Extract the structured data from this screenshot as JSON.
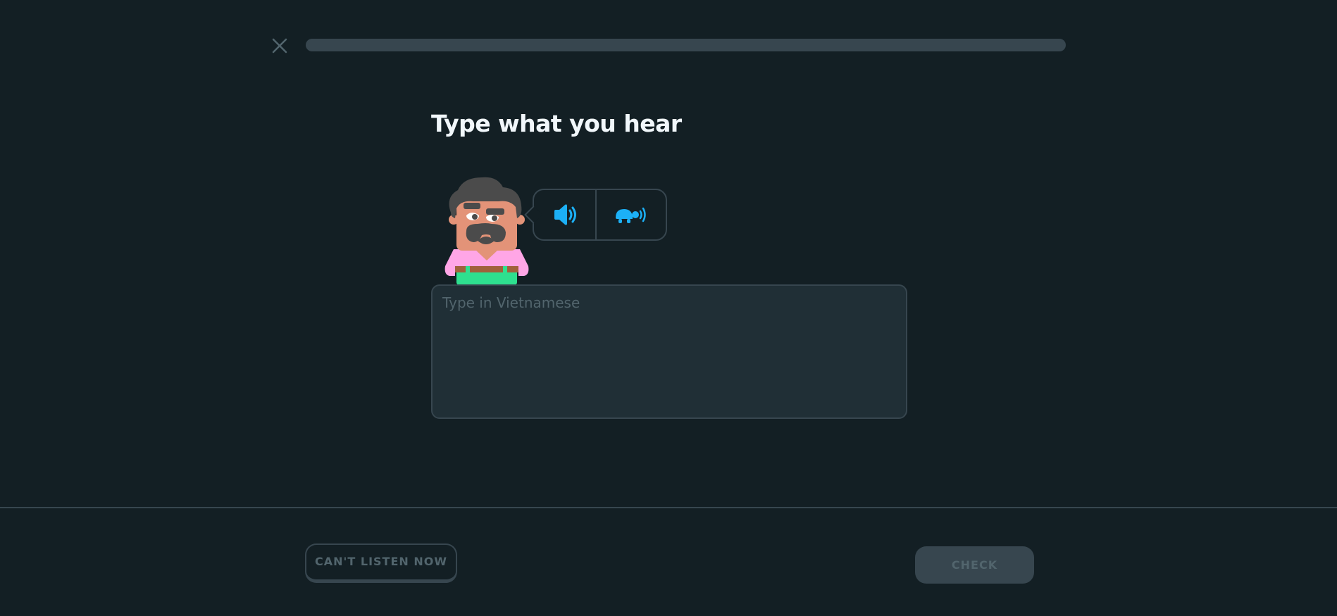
{
  "header": {
    "close_icon": "close-icon",
    "progress": 0
  },
  "challenge": {
    "title": "Type what you hear",
    "character": "mustached-man-character",
    "audio": {
      "normal_icon": "speaker-icon",
      "slow_icon": "turtle-speaker-icon",
      "accent_color": "#1cb0f6"
    },
    "answer": {
      "value": "",
      "placeholder": "Type in Vietnamese"
    }
  },
  "footer": {
    "cant_listen_label": "CAN'T LISTEN NOW",
    "check_label": "CHECK"
  }
}
